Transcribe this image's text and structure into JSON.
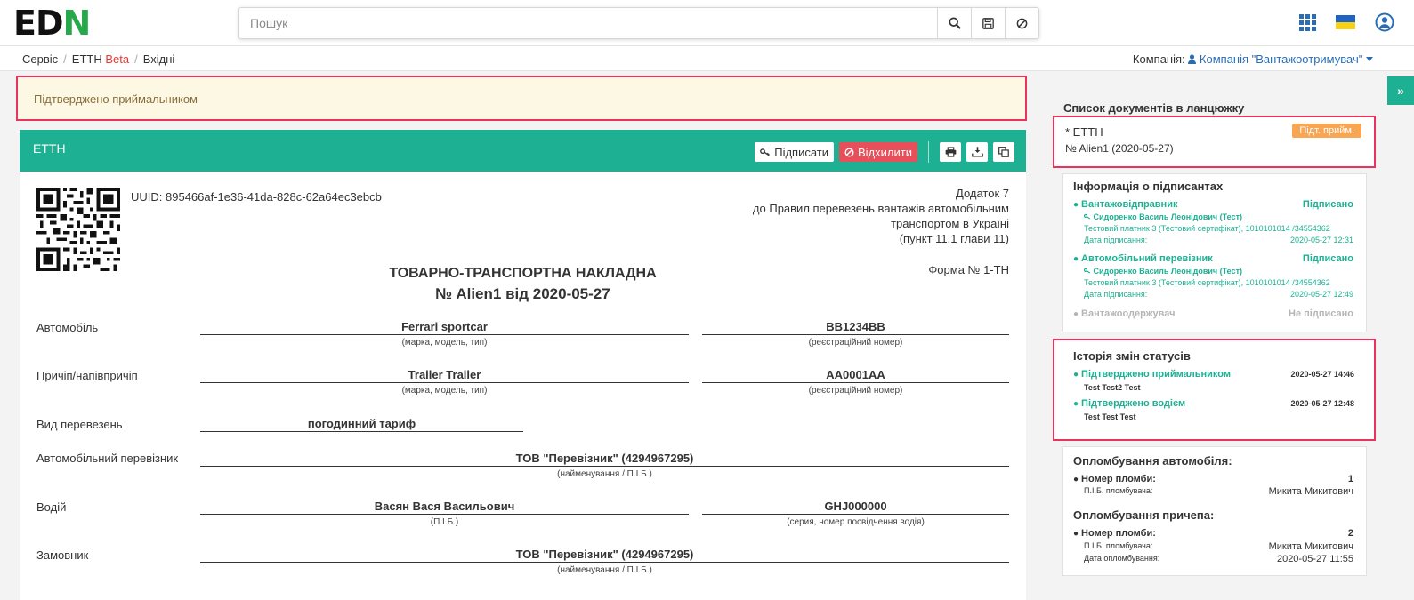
{
  "header": {
    "logo_left": "ED",
    "logo_right": "N",
    "search_placeholder": "Пошук",
    "icons": [
      "search-icon",
      "save-icon",
      "ban-icon",
      "apps-grid-icon",
      "ukraine-flag-icon",
      "user-icon"
    ]
  },
  "breadcrumb": {
    "items": [
      "Сервіс",
      "ЕТТН",
      "Вхідні"
    ],
    "beta_label": "Beta",
    "separator": "/"
  },
  "company": {
    "label": "Компанія:",
    "value": "Компанія \"Вантажоотримувач\""
  },
  "alert": {
    "text": "Підтверджено приймальником"
  },
  "panel": {
    "title": "ЕТТН",
    "sign_label": "Підписати",
    "reject_label": "Відхилити"
  },
  "document": {
    "uuid": "UUID: 895466af-1e36-41da-828c-62a64ec3ebcb",
    "dodatok": [
      "Додаток 7",
      "до Правил перевезень вантажів автомобільним",
      "транспортом в Україні",
      "(пункт 11.1 глави 11)"
    ],
    "forma": "Форма № 1-ТН",
    "title": "ТОВАРНО-ТРАНСПОРТНА НАКЛАДНА",
    "number": "№ Alien1 від 2020-05-27",
    "rows": {
      "auto": {
        "label": "Автомобіль",
        "model": "Ferrari sportcar",
        "model_hint": "(марка, модель, тип)",
        "reg": "BB1234BB",
        "reg_hint": "(реєстраційний номер)"
      },
      "trailer": {
        "label": "Причіп/напівпричіп",
        "model": "Trailer Trailer",
        "model_hint": "(марка, модель, тип)",
        "reg": "AA0001AA",
        "reg_hint": "(реєстраційний номер)"
      },
      "transport_kind": {
        "label": "Вид перевезень",
        "value": "погодинний тариф"
      },
      "carrier": {
        "label": "Автомобільний перевізник",
        "value": "ТОВ \"Перевізник\" (4294967295)",
        "hint": "(найменування / П.І.Б.)"
      },
      "driver": {
        "label": "Водій",
        "name": "Васян Вася Васильович",
        "name_hint": "(П.І.Б.)",
        "license": "GHJ000000",
        "license_hint": "(серия, номер посвідчення водія)"
      },
      "customer": {
        "label": "Замовник",
        "value": "ТОВ \"Перевізник\" (4294967295)",
        "hint": "(найменування / П.І.Б.)"
      }
    }
  },
  "sidebar": {
    "chain_heading": "Список документів в ланцюжку",
    "chain_doc": {
      "title": "* ЕТТН",
      "number": "№ Alien1 (2020-05-27)",
      "badge": "Підт. прийм."
    },
    "signers": {
      "heading": "Інформація о підписантах",
      "items": [
        {
          "role": "Вантажовідправник",
          "status": "Підписано",
          "person": "Сидоренко Василь Леонідович (Тест)",
          "cert": "Тестовий платник 3 (Тестовий сертифікат), 1010101014 /34554362",
          "date_label": "Дата підписання:",
          "date": "2020-05-27 12:31"
        },
        {
          "role": "Автомобільний перевізник",
          "status": "Підписано",
          "person": "Сидоренко Василь Леонідович (Тест)",
          "cert": "Тестовий платник 3 (Тестовий сертифікат), 1010101014 /34554362",
          "date_label": "Дата підписання:",
          "date": "2020-05-27 12:49"
        },
        {
          "role": "Вантажоодержувач",
          "status": "Не підписано"
        }
      ]
    },
    "history": {
      "heading": "Історія змін статусів",
      "items": [
        {
          "status": "Підтверджено приймальником",
          "date": "2020-05-27 14:46",
          "who": "Test Test2 Test"
        },
        {
          "status": "Підтверджено водієм",
          "date": "2020-05-27 12:48",
          "who": "Test Test Test"
        }
      ]
    },
    "seals": {
      "auto_heading": "Опломбування автомобіля:",
      "auto": {
        "num_label": "Номер пломби:",
        "num": "1",
        "who_label": "П.І.Б. пломбувача:",
        "who": "Микита Микитович"
      },
      "trailer_heading": "Опломбування причепа:",
      "trailer": {
        "num_label": "Номер пломби:",
        "num": "2",
        "who_label": "П.І.Б. пломбувача:",
        "who": "Микита Микитович",
        "date_label": "Дата опломбування:",
        "date": "2020-05-27 11:55"
      }
    }
  },
  "colors": {
    "accent": "#1db092",
    "alert_border": "#e8335c",
    "danger": "#e7505a",
    "badge": "#f9a654",
    "link": "#2a6db5"
  }
}
